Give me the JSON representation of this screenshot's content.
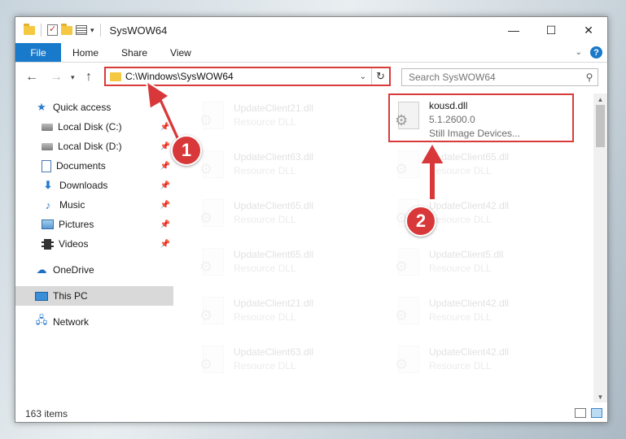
{
  "window": {
    "title": "SysWOW64",
    "controls": {
      "minimize": "—",
      "maximize": "☐",
      "close": "✕"
    }
  },
  "ribbon": {
    "tabs": [
      {
        "label": "File"
      },
      {
        "label": "Home"
      },
      {
        "label": "Share"
      },
      {
        "label": "View"
      }
    ],
    "help": "?"
  },
  "navigation": {
    "address": "C:\\Windows\\SysWOW64",
    "search_placeholder": "Search SysWOW64"
  },
  "sidebar": {
    "items": [
      {
        "label": "Quick access",
        "icon": "star-icon",
        "pinned": false
      },
      {
        "label": "Local Disk (C:)",
        "icon": "drive-icon",
        "pinned": true
      },
      {
        "label": "Local Disk (D:)",
        "icon": "drive-icon",
        "pinned": true
      },
      {
        "label": "Documents",
        "icon": "document-icon",
        "pinned": true
      },
      {
        "label": "Downloads",
        "icon": "download-icon",
        "pinned": true
      },
      {
        "label": "Music",
        "icon": "music-icon",
        "pinned": true
      },
      {
        "label": "Pictures",
        "icon": "pictures-icon",
        "pinned": true
      },
      {
        "label": "Videos",
        "icon": "videos-icon",
        "pinned": true
      },
      {
        "label": "OneDrive",
        "icon": "cloud-icon",
        "pinned": false
      },
      {
        "label": "This PC",
        "icon": "computer-icon",
        "pinned": false,
        "selected": true
      },
      {
        "label": "Network",
        "icon": "network-icon",
        "pinned": false
      }
    ]
  },
  "files": {
    "left": [
      {
        "name": "UpdateClient21.dll",
        "sub": "Resource DLL"
      },
      {
        "name": "UpdateClient63.dll",
        "sub": "Resource DLL"
      },
      {
        "name": "UpdateClient65.dll",
        "sub": "Resource DLL"
      },
      {
        "name": "UpdateClient65.dll",
        "sub": "Resource DLL"
      },
      {
        "name": "UpdateClient21.dll",
        "sub": "Resource DLL"
      },
      {
        "name": "UpdateClient63.dll",
        "sub": "Resource DLL"
      }
    ],
    "right": [
      {
        "name": "kousd.dll",
        "sub": "5.1.2600.0",
        "sub2": "Still Image Devices...",
        "highlighted": true
      },
      {
        "name": "UpdateClient65.dll",
        "sub": "Resource DLL"
      },
      {
        "name": "UpdateClient42.dll",
        "sub": "Resource DLL"
      },
      {
        "name": "UpdateClient5.dll",
        "sub": "Resource DLL"
      },
      {
        "name": "UpdateClient42.dll",
        "sub": "Resource DLL"
      },
      {
        "name": "UpdateClient42.dll",
        "sub": "Resource DLL"
      }
    ]
  },
  "status": {
    "item_count": "163 items"
  },
  "annotations": {
    "step1": "1",
    "step2": "2",
    "color": "#d8383a"
  }
}
